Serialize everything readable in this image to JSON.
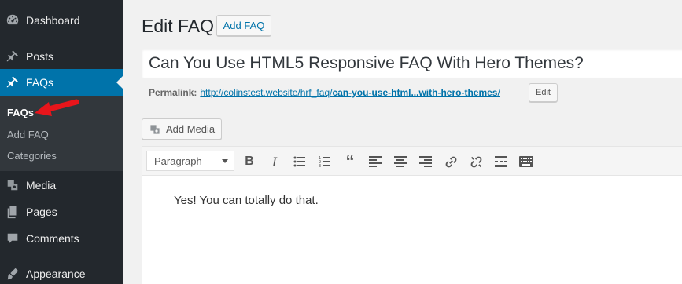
{
  "sidebar": {
    "dashboard": {
      "label": "Dashboard",
      "icon": "dashboard-icon"
    },
    "posts": {
      "label": "Posts",
      "icon": "pin-icon"
    },
    "faqs": {
      "label": "FAQs",
      "icon": "pin-icon"
    },
    "submenu": [
      "FAQs",
      "Add FAQ",
      "Categories"
    ],
    "media": {
      "label": "Media",
      "icon": "media-icon"
    },
    "pages": {
      "label": "Pages",
      "icon": "pages-icon"
    },
    "comments": {
      "label": "Comments",
      "icon": "comments-icon"
    },
    "appearance": {
      "label": "Appearance",
      "icon": "appearance-icon"
    }
  },
  "header": {
    "title": "Edit FAQ",
    "add_button": "Add FAQ"
  },
  "post": {
    "title": "Can You Use HTML5 Responsive FAQ With Hero Themes?",
    "permalink_label": "Permalink:",
    "permalink_base": "http://colinstest.website/hrf_faq/",
    "permalink_slug": "can-you-use-html...with-hero-themes",
    "permalink_trail": "/",
    "edit_button": "Edit"
  },
  "editor": {
    "add_media": "Add Media",
    "format": "Paragraph",
    "content": "Yes! You can totally do that."
  },
  "colors": {
    "sidebar_bg": "#23282d",
    "submenu_bg": "#32373c",
    "active_bg": "#0073aa",
    "annotation_arrow": "#e8151b"
  }
}
